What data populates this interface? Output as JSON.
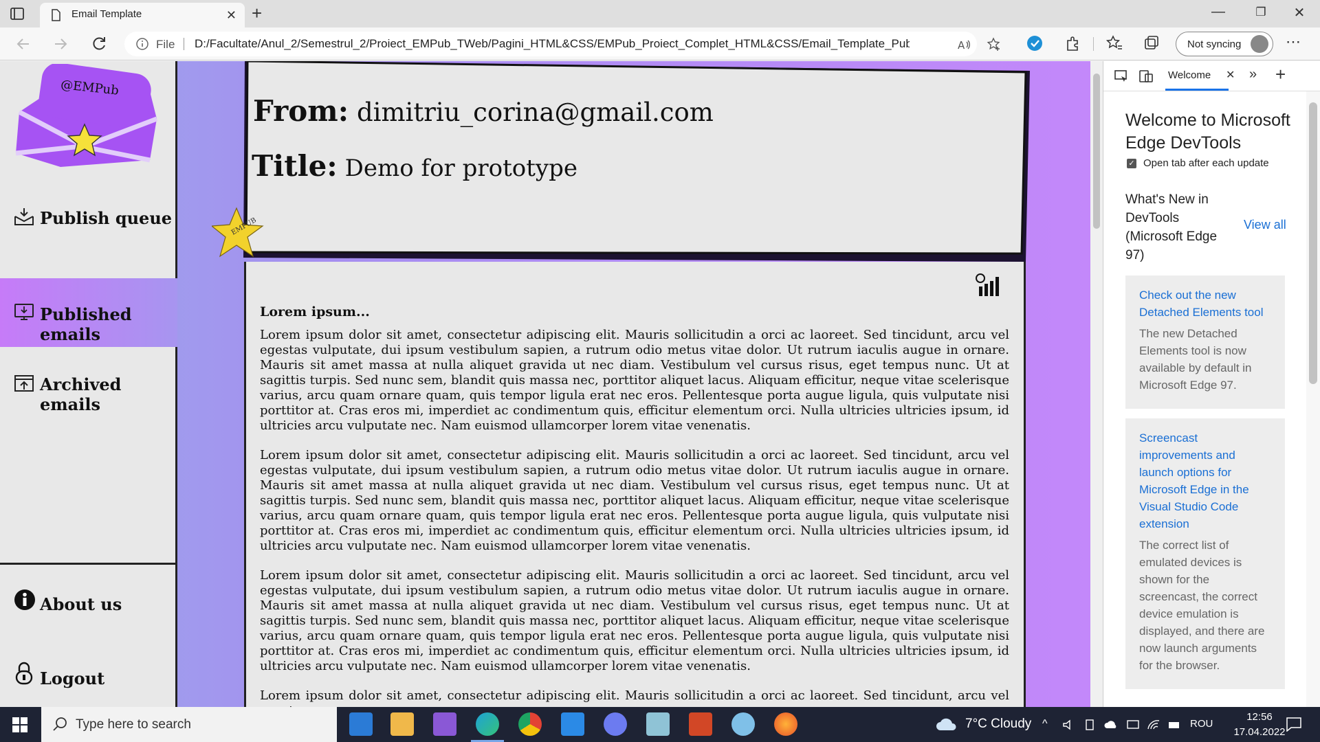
{
  "browser": {
    "tab_title": "Email Template",
    "omnibox_scheme": "File",
    "url": "D:/Facultate/Anul_2/Semestrul_2/Proiect_EMPub_TWeb/Pagini_HTML&CSS/EMPub_Proiect_Complet_HTML&CSS/Email_Template_Publishe...",
    "sync_label": "Not syncing"
  },
  "sidebar": {
    "logo_text": "@EMPub",
    "items": [
      {
        "label": "Publish queue",
        "icon": "download-tray-icon"
      },
      {
        "label": "Published emails",
        "icon": "monitor-down-icon",
        "active": true
      },
      {
        "label": "Archived emails",
        "icon": "upload-tray-icon"
      }
    ],
    "bottom_items": [
      {
        "label": "About us",
        "icon": "info-icon"
      },
      {
        "label": "Logout",
        "icon": "lock-icon"
      }
    ]
  },
  "email": {
    "from_label": "From:",
    "from_value": "dimitriu_corina@gmail.com",
    "title_label": "Title:",
    "title_value": "Demo for prototype",
    "star_badge_text": "EMPUB",
    "heading": "Lorem ipsum...",
    "paragraphs": [
      "Lorem ipsum dolor sit amet, consectetur adipiscing elit. Mauris sollicitudin a orci ac laoreet. Sed tincidunt, arcu vel egestas vulputate, dui ipsum vestibulum sapien, a rutrum odio metus vitae dolor. Ut rutrum iaculis augue in ornare. Mauris sit amet massa at nulla aliquet gravida ut nec diam. Vestibulum vel cursus risus, eget tempus nunc. Ut at sagittis turpis. Sed nunc sem, blandit quis massa nec, porttitor aliquet lacus. Aliquam efficitur, neque vitae scelerisque varius, arcu quam ornare quam, quis tempor ligula erat nec eros. Pellentesque porta augue ligula, quis vulputate nisi porttitor at. Cras eros mi, imperdiet ac condimentum quis, efficitur elementum orci. Nulla ultricies ultricies ipsum, id ultricies arcu vulputate nec. Nam euismod ullamcorper lorem vitae venenatis.",
      "Lorem ipsum dolor sit amet, consectetur adipiscing elit. Mauris sollicitudin a orci ac laoreet. Sed tincidunt, arcu vel egestas vulputate, dui ipsum vestibulum sapien, a rutrum odio metus vitae dolor. Ut rutrum iaculis augue in ornare. Mauris sit amet massa at nulla aliquet gravida ut nec diam. Vestibulum vel cursus risus, eget tempus nunc. Ut at sagittis turpis. Sed nunc sem, blandit quis massa nec, porttitor aliquet lacus. Aliquam efficitur, neque vitae scelerisque varius, arcu quam ornare quam, quis tempor ligula erat nec eros. Pellentesque porta augue ligula, quis vulputate nisi porttitor at. Cras eros mi, imperdiet ac condimentum quis, efficitur elementum orci. Nulla ultricies ultricies ipsum, id ultricies arcu vulputate nec. Nam euismod ullamcorper lorem vitae venenatis.",
      "Lorem ipsum dolor sit amet, consectetur adipiscing elit. Mauris sollicitudin a orci ac laoreet. Sed tincidunt, arcu vel egestas vulputate, dui ipsum vestibulum sapien, a rutrum odio metus vitae dolor. Ut rutrum iaculis augue in ornare. Mauris sit amet massa at nulla aliquet gravida ut nec diam. Vestibulum vel cursus risus, eget tempus nunc. Ut at sagittis turpis. Sed nunc sem, blandit quis massa nec, porttitor aliquet lacus. Aliquam efficitur, neque vitae scelerisque varius, arcu quam ornare quam, quis tempor ligula erat nec eros. Pellentesque porta augue ligula, quis vulputate nisi porttitor at. Cras eros mi, imperdiet ac condimentum quis, efficitur elementum orci. Nulla ultricies ultricies ipsum, id ultricies arcu vulputate nec. Nam euismod ullamcorper lorem vitae venenatis.",
      "Lorem ipsum dolor sit amet, consectetur adipiscing elit. Mauris sollicitudin a orci ac laoreet. Sed tincidunt, arcu vel egestas"
    ]
  },
  "devtools": {
    "tab_label": "Welcome",
    "heading": "Welcome to Microsoft Edge DevTools",
    "checkbox_label": "Open tab after each update",
    "whats_new_title": "What's New in DevTools (Microsoft Edge 97)",
    "view_all": "View all",
    "cards": [
      {
        "link": "Check out the new Detached Elements tool",
        "desc": "The new Detached Elements tool is now available by default in Microsoft Edge 97."
      },
      {
        "link": "Screencast improvements and launch options for Microsoft Edge in the Visual Studio Code extension",
        "desc": "The correct list of emulated devices is shown for the screencast, the correct device emulation is displayed, and there are now launch arguments for the browser."
      }
    ]
  },
  "taskbar": {
    "search_placeholder": "Type here to search",
    "weather": "7°C  Cloudy",
    "language": "ROU",
    "time": "12:56",
    "date": "17.04.2022",
    "apps": [
      "mail-icon",
      "file-explorer-icon",
      "visual-studio-icon",
      "edge-icon",
      "chrome-icon",
      "vscode-icon",
      "discord-icon",
      "notes-icon",
      "powerpoint-icon",
      "paint-icon",
      "firefox-icon"
    ]
  },
  "colors": {
    "page_gradient_left": "#9ba9ea",
    "page_gradient_right": "#c388fa",
    "active_item": "#c67bf8",
    "card_bg": "#e8e8e8",
    "link_blue": "#1a6fd4",
    "taskbar": "#1e2334"
  }
}
